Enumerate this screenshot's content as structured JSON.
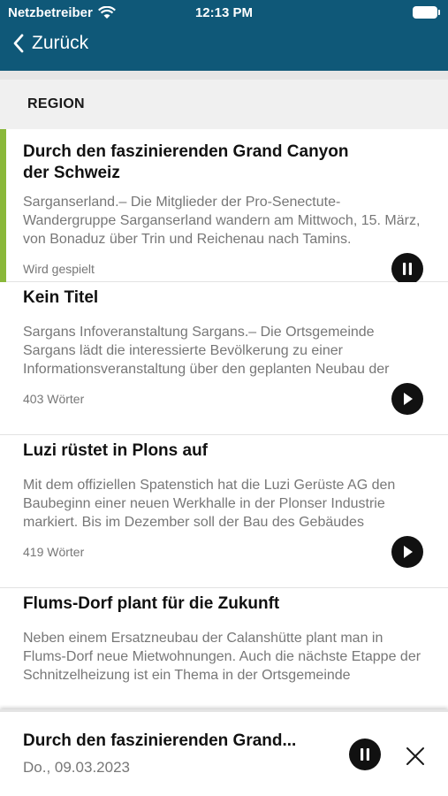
{
  "status": {
    "carrier": "Netzbetreiber",
    "time": "12:13 PM"
  },
  "nav": {
    "back_label": "Zurück"
  },
  "section": {
    "label": "REGION"
  },
  "articles": [
    {
      "title": "Durch den faszinierenden Grand Canyon der Schweiz",
      "excerpt": "Sarganserland.– Die Mitglieder der Pro-Senectute-Wandergruppe Sarganserland wandern am Mittwoch, 15. März, von Bonaduz über Trin und Reichenau nach Tamins.",
      "meta": "Wird gespielt",
      "state": "pause-icon"
    },
    {
      "title": "Kein Titel",
      "excerpt": "Sargans Infoveranstaltung Sargans.– Die Ortsgemeinde Sargans lädt die interessierte Bevölkerung zu einer Informationsveranstaltung über den geplanten Neubau der",
      "meta": "403 Wörter",
      "state": "play-icon"
    },
    {
      "title": "Luzi rüstet in Plons auf",
      "excerpt": "Mit dem offiziellen Spatenstich hat die Luzi Gerüste AG den Baubeginn einer neuen Werkhalle in der Plonser Industrie markiert. Bis im Dezember soll der Bau des Gebäudes",
      "meta": "419 Wörter",
      "state": "play-icon"
    },
    {
      "title": "Flums-Dorf plant für die Zukunft",
      "excerpt": "Neben einem Ersatzneubau der Calanshütte plant man in Flums-Dorf neue Mietwohnungen. Auch die nächste Etappe der Schnitzelheizung ist ein Thema in der Ortsgemeinde",
      "meta": "",
      "state": "play-icon"
    }
  ],
  "player": {
    "title": "Durch den faszinierenden Grand...",
    "date": "Do., 09.03.2023"
  },
  "colors": {
    "header": "#0f5878",
    "active": "#8ab83a"
  }
}
